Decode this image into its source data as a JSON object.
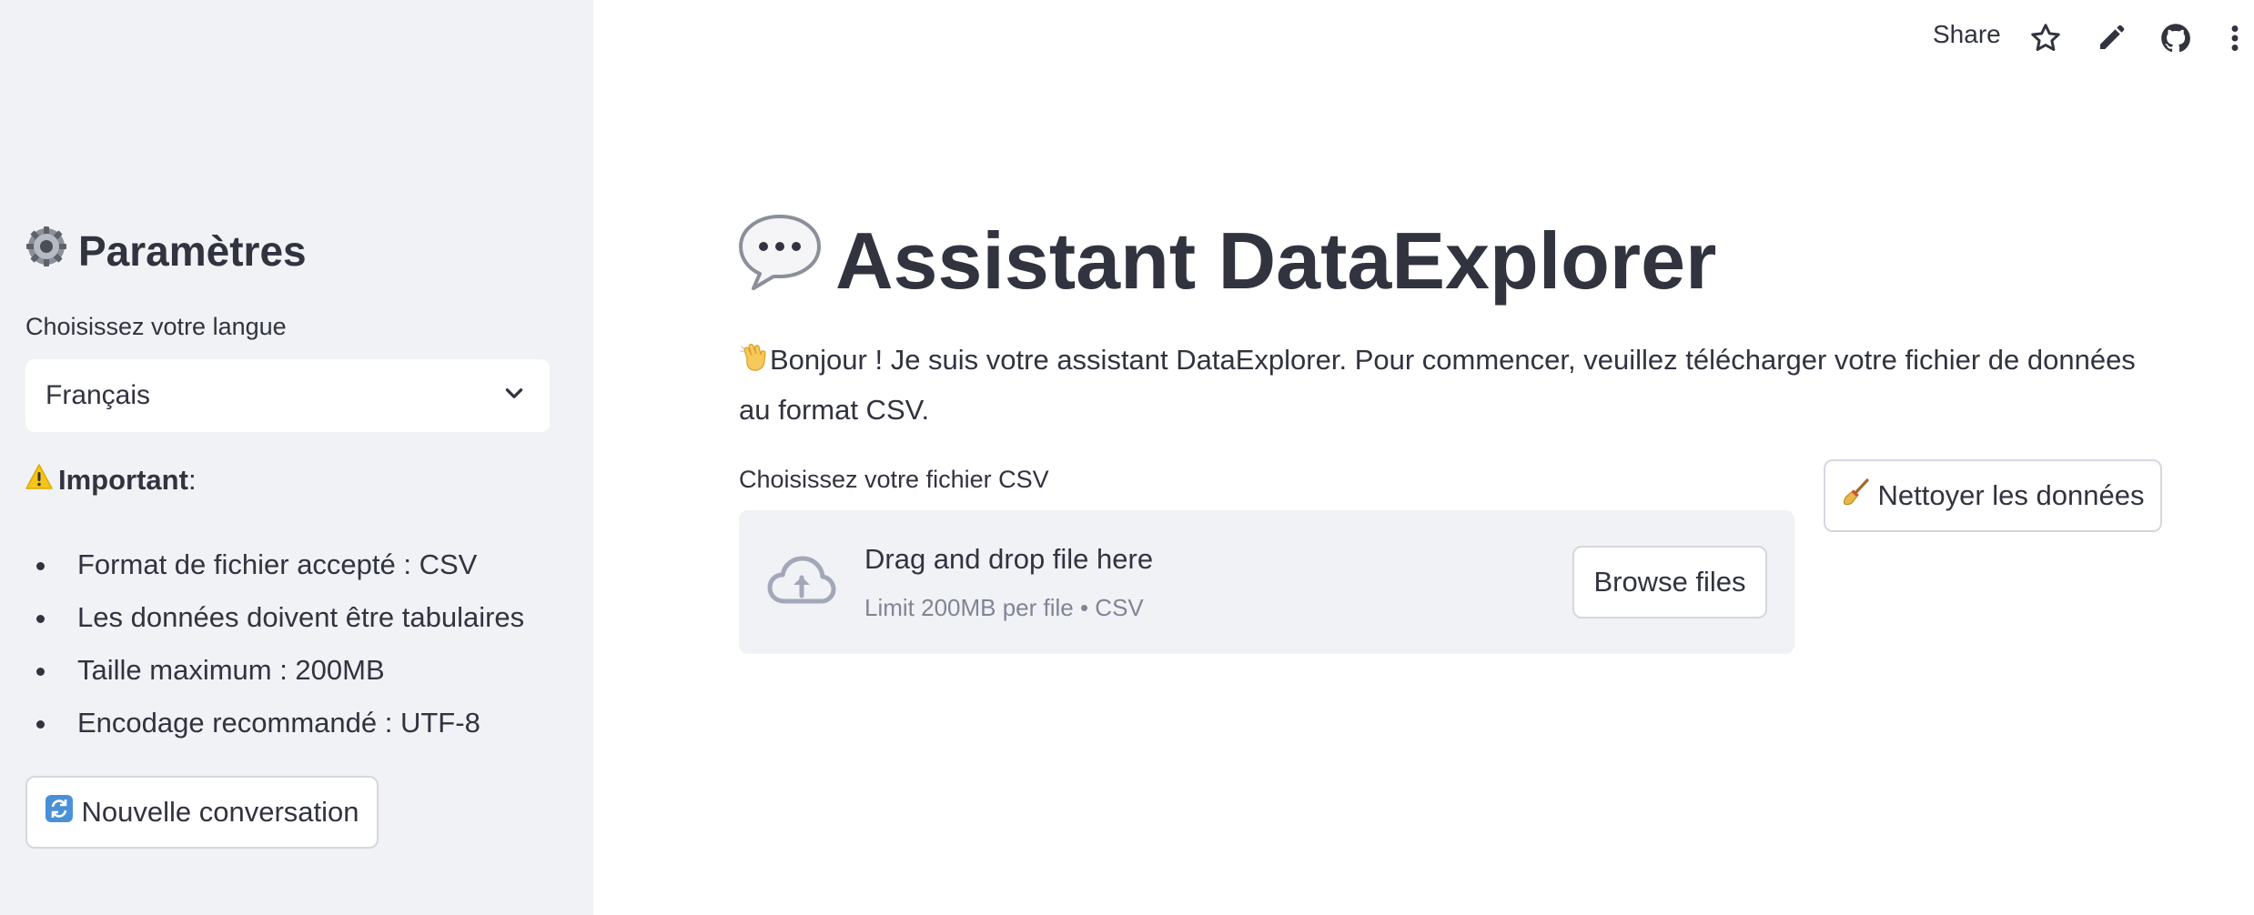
{
  "sidebar": {
    "title": "Paramètres",
    "title_icon": "gear-icon",
    "language_label": "Choisissez votre langue",
    "language_value": "Français",
    "important_label": "Important",
    "important_suffix": " :",
    "important_icon": "warning-icon",
    "notes": [
      "Format de fichier accepté : CSV",
      "Les données doivent être tabulaires",
      "Taille maximum : 200MB",
      "Encodage recommandé : UTF-8"
    ],
    "new_conversation_label": "Nouvelle conversation",
    "new_conversation_icon": "refresh-icon"
  },
  "toolbar": {
    "share_label": "Share",
    "icons": [
      "star-icon",
      "pencil-icon",
      "github-icon",
      "more-vertical-icon"
    ]
  },
  "main": {
    "title": "Assistant DataExplorer",
    "title_icon": "speech-bubble-icon",
    "intro_icon": "waving-hand-icon",
    "intro": "Bonjour ! Je suis votre assistant DataExplorer. Pour commencer, veuillez télécharger votre fichier de données au format CSV.",
    "upload_label": "Choisissez votre fichier CSV",
    "dropzone_main": "Drag and drop file here",
    "dropzone_sub": "Limit 200MB per file • CSV",
    "browse_label": "Browse files",
    "clean_label": "Nettoyer les données",
    "clean_icon": "broom-icon"
  },
  "colors": {
    "sidebar_bg": "#f0f2f6",
    "text": "#31333f",
    "muted": "#808495",
    "border": "#d5d7de"
  }
}
